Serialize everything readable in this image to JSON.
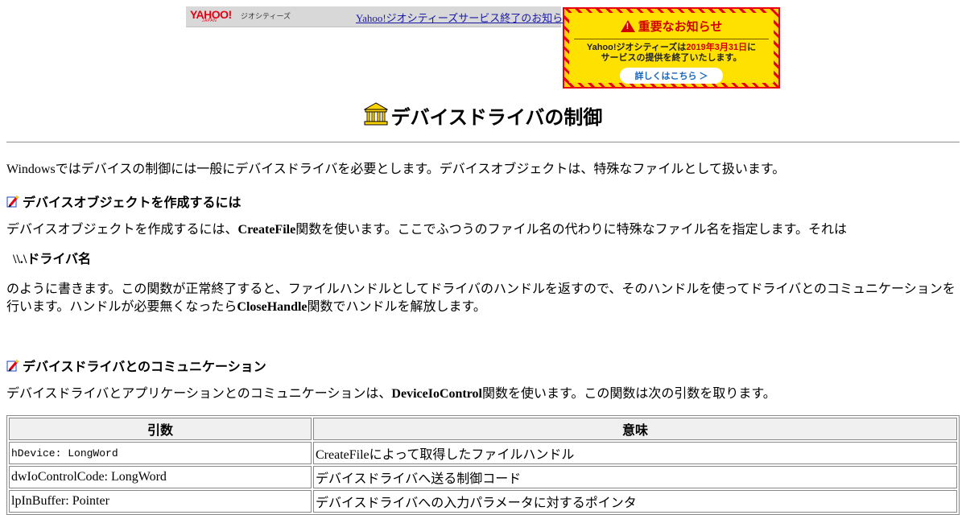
{
  "banner": {
    "logo_text": "YAHOO!",
    "logo_sub": "JAPAN",
    "service_label": "ジオシティーズ",
    "link_text": "Yahoo!ジオシティーズサービス終了のお知らせ"
  },
  "notice": {
    "title": "重要なお知らせ",
    "line1_a": "Yahoo!ジオシティーズは",
    "line1_hl": "2019年3月31日",
    "line1_b": "に",
    "line2": "サービスの提供を終了いたします。",
    "button": "詳しくはこちら ＞"
  },
  "page": {
    "title": "デバイスドライバの制御",
    "intro": "Windowsではデバイスの制御には一般にデバイスドライバを必要とします。デバイスオブジェクトは、特殊なファイルとして扱います。",
    "section1": {
      "heading": "デバイスオブジェクトを作成するには",
      "p1_a": "デバイスオブジェクトを作成するには、",
      "p1_bold": "CreateFile",
      "p1_b": "関数を使います。ここでふつうのファイル名の代わりに特殊なファイル名を指定します。それは",
      "path": "\\\\.\\ドライバ名",
      "p2_a": "のように書きます。この関数が正常終了すると、ファイルハンドルとしてドライバのハンドルを返すので、そのハンドルを使ってドライバとのコミュニケーションを行います。ハンドルが必要無くなったら",
      "p2_bold": "CloseHandle",
      "p2_b": "関数でハンドルを解放します。"
    },
    "section2": {
      "heading": "デバイスドライバとのコミュニケーション",
      "p1_a": "デバイスドライバとアプリケーションとのコミュニケーションは、",
      "p1_bold": "DeviceIoControl",
      "p1_b": "関数を使います。この関数は次の引数を取ります。"
    }
  },
  "table": {
    "headers": [
      "引数",
      "意味"
    ],
    "rows": [
      [
        "hDevice: LongWord",
        "CreateFileによって取得したファイルハンドル"
      ],
      [
        "dwIoControlCode: LongWord",
        "デバイスドライバへ送る制御コード"
      ],
      [
        "lpInBuffer: Pointer",
        "デバイスドライバへの入力パラメータに対するポインタ"
      ]
    ]
  }
}
